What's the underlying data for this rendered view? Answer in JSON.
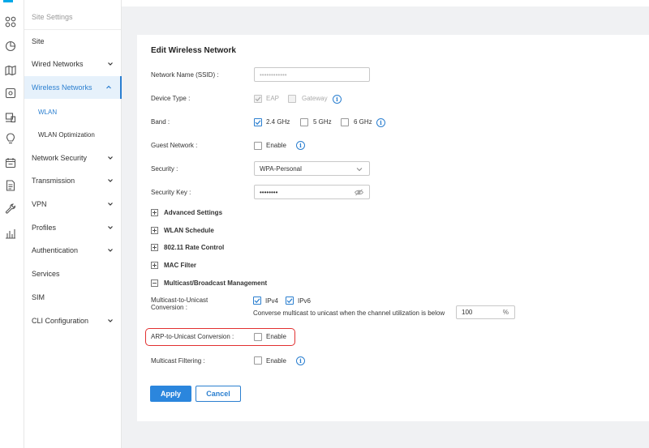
{
  "sidebar": {
    "title": "Site Settings",
    "items": [
      {
        "label": "Site"
      },
      {
        "label": "Wired Networks"
      },
      {
        "label": "Wireless Networks"
      },
      {
        "label": "WLAN"
      },
      {
        "label": "WLAN Optimization"
      },
      {
        "label": "Network Security"
      },
      {
        "label": "Transmission"
      },
      {
        "label": "VPN"
      },
      {
        "label": "Profiles"
      },
      {
        "label": "Authentication"
      },
      {
        "label": "Services"
      },
      {
        "label": "SIM"
      },
      {
        "label": "CLI Configuration"
      }
    ]
  },
  "form": {
    "title": "Edit Wireless Network",
    "ssid": {
      "label": "Network Name (SSID) :",
      "value": "••••••••••••"
    },
    "device_type": {
      "label": "Device Type :",
      "eap": "EAP",
      "gateway": "Gateway"
    },
    "band": {
      "label": "Band :",
      "b24": "2.4 GHz",
      "b5": "5 GHz",
      "b6": "6 GHz"
    },
    "guest": {
      "label": "Guest Network :",
      "enable": "Enable"
    },
    "security": {
      "label": "Security :",
      "value": "WPA-Personal"
    },
    "security_key": {
      "label": "Security Key :",
      "value": "••••••••"
    },
    "sections": {
      "advanced": "Advanced Settings",
      "schedule": "WLAN Schedule",
      "rate": "802.11 Rate Control",
      "mac": "MAC Filter",
      "multicast": "Multicast/Broadcast Management"
    },
    "m2u": {
      "label": "Multicast-to-Unicast Conversion :",
      "ipv4": "IPv4",
      "ipv6": "IPv6",
      "converse_text": "Converse multicast to unicast when the channel utilization is below",
      "threshold": "100",
      "unit": "%"
    },
    "arp": {
      "label": "ARP-to-Unicast Conversion :",
      "enable": "Enable"
    },
    "mcast_filter": {
      "label": "Multicast Filtering :",
      "enable": "Enable"
    },
    "apply": "Apply",
    "cancel": "Cancel"
  },
  "icons": {
    "info_glyph": "i",
    "rail": [
      "dashboard-icon",
      "statistics-icon",
      "map-icon",
      "devices-icon",
      "clients-icon",
      "insight-icon",
      "schedule-icon",
      "logs-icon",
      "tools-icon",
      "reports-icon"
    ]
  },
  "colors": {
    "accent": "#2b7fd0",
    "highlight": "#e23030"
  }
}
